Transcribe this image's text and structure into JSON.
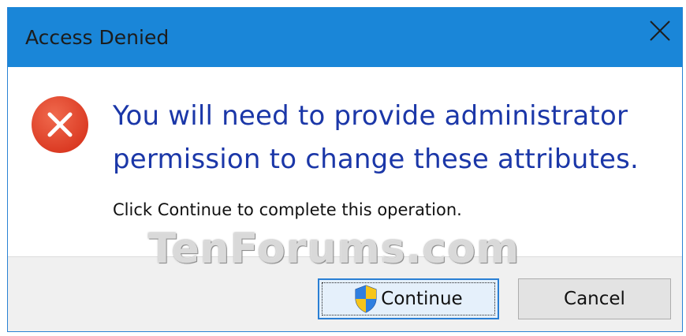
{
  "window": {
    "title": "Access Denied",
    "close_icon": "close-icon"
  },
  "content": {
    "icon": "error-icon",
    "main_instruction_line1": "You will need to provide administrator",
    "main_instruction_line2": "permission to change these attributes.",
    "sub_text": "Click Continue to complete this operation."
  },
  "buttons": {
    "continue_label": "Continue",
    "continue_icon": "uac-shield-icon",
    "cancel_label": "Cancel"
  },
  "watermark": {
    "text": "TenForums.com"
  },
  "colors": {
    "titlebar": "#1a86d8",
    "instruction_text": "#1b37a8",
    "error_red": "#e8402a",
    "footer": "#f0f0f0"
  }
}
